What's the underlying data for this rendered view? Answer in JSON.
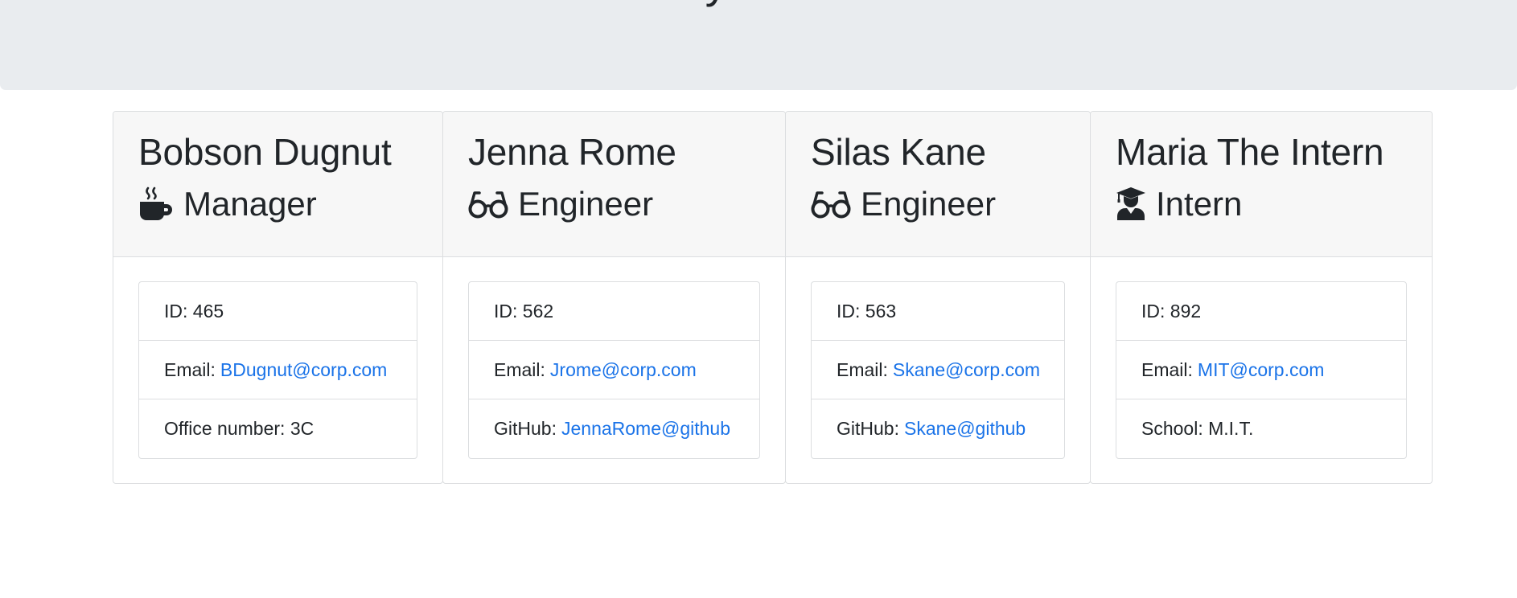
{
  "header": {
    "title": "My Team"
  },
  "colors": {
    "jumbotron_bg": "#e9ecef",
    "card_header_bg": "#f7f7f7",
    "link": "#1a73e8",
    "text": "#212529"
  },
  "team": [
    {
      "name": "Bobson Dugnut",
      "role": "Manager",
      "icon": "coffee-mug-icon",
      "id_label": "ID:",
      "id_value": "465",
      "email_label": "Email:",
      "email": "BDugnut@corp.com",
      "extra_label": "Office number:",
      "extra_value": "3C"
    },
    {
      "name": "Jenna Rome",
      "role": "Engineer",
      "icon": "glasses-icon",
      "id_label": "ID:",
      "id_value": "562",
      "email_label": "Email:",
      "email": "Jrome@corp.com",
      "extra_label": "GitHub:",
      "extra_value": "JennaRome@github"
    },
    {
      "name": "Silas Kane",
      "role": "Engineer",
      "icon": "glasses-icon",
      "id_label": "ID:",
      "id_value": "563",
      "email_label": "Email:",
      "email": "Skane@corp.com",
      "extra_label": "GitHub:",
      "extra_value": "Skane@github"
    },
    {
      "name": "Maria The Intern",
      "role": "Intern",
      "icon": "graduate-icon",
      "id_label": "ID:",
      "id_value": "892",
      "email_label": "Email:",
      "email": "MIT@corp.com",
      "extra_label": "School:",
      "extra_value": "M.I.T."
    }
  ]
}
